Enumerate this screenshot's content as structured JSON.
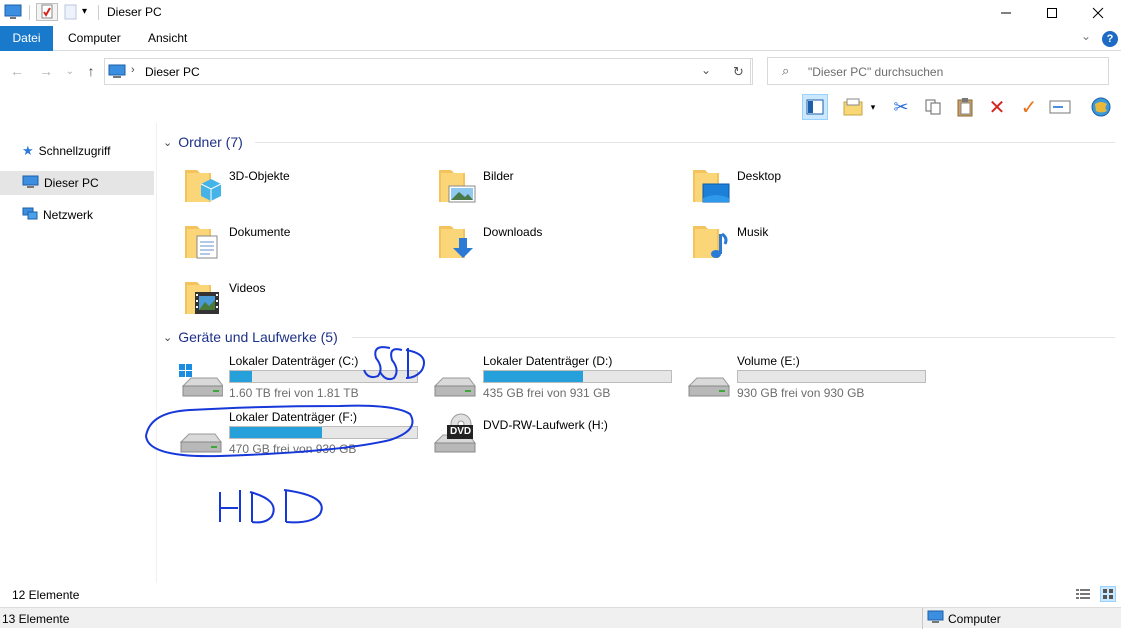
{
  "window": {
    "title": "Dieser PC"
  },
  "ribbon": {
    "tabs": [
      "Datei",
      "Computer",
      "Ansicht"
    ]
  },
  "address": {
    "path": "Dieser PC",
    "search_placeholder": "\"Dieser PC\" durchsuchen"
  },
  "sidebar": {
    "items": [
      {
        "label": "Schnellzugriff",
        "icon": "star-icon"
      },
      {
        "label": "Dieser PC",
        "icon": "computer-icon",
        "selected": true
      },
      {
        "label": "Netzwerk",
        "icon": "network-icon"
      }
    ]
  },
  "groups": {
    "folders": {
      "header": "Ordner (7)",
      "items": [
        {
          "label": "3D-Objekte",
          "icon": "3d-objects-folder-icon"
        },
        {
          "label": "Bilder",
          "icon": "pictures-folder-icon"
        },
        {
          "label": "Desktop",
          "icon": "desktop-folder-icon"
        },
        {
          "label": "Dokumente",
          "icon": "documents-folder-icon"
        },
        {
          "label": "Downloads",
          "icon": "downloads-folder-icon"
        },
        {
          "label": "Musik",
          "icon": "music-folder-icon"
        },
        {
          "label": "Videos",
          "icon": "videos-folder-icon"
        }
      ]
    },
    "devices": {
      "header": "Geräte und Laufwerke (5)",
      "items": [
        {
          "name": "Lokaler Datenträger (C:)",
          "free": "1.60 TB frei von 1.81 TB",
          "used_fraction": 0.12,
          "icon": "windows-drive-icon"
        },
        {
          "name": "Lokaler Datenträger (D:)",
          "free": "435 GB frei von 931 GB",
          "used_fraction": 0.53,
          "icon": "hard-drive-icon"
        },
        {
          "name": "Volume (E:)",
          "free": "930 GB frei von 930 GB",
          "used_fraction": 0.0,
          "icon": "hard-drive-icon"
        },
        {
          "name": "Lokaler Datenträger (F:)",
          "free": "470 GB frei von 930 GB",
          "used_fraction": 0.49,
          "icon": "hard-drive-icon"
        },
        {
          "name": "DVD-RW-Laufwerk (H:)",
          "free": "",
          "used_fraction": null,
          "icon": "dvd-drive-icon"
        }
      ]
    }
  },
  "annotations": {
    "ssd_label": "SSD",
    "hdd_label": "HDD"
  },
  "status": {
    "item_count": "12 Elemente",
    "bottom_count": "13 Elemente",
    "location": "Computer"
  },
  "dvd_badge": "DVD"
}
